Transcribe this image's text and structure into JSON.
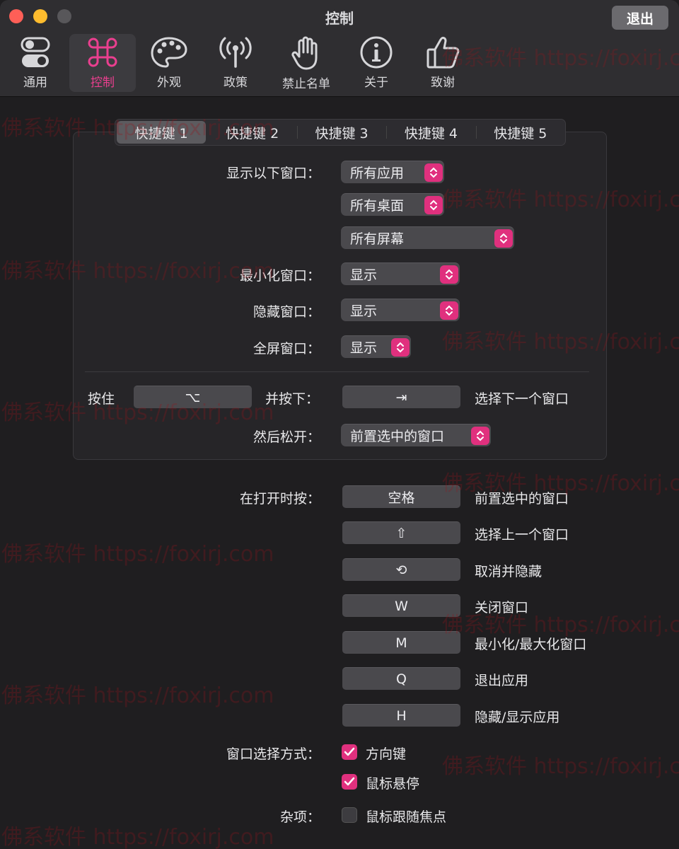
{
  "window": {
    "title": "控制",
    "quit_label": "退出"
  },
  "toolbar": [
    {
      "label": "通用",
      "icon": "toggle-icon"
    },
    {
      "label": "控制",
      "icon": "command-icon"
    },
    {
      "label": "外观",
      "icon": "palette-icon"
    },
    {
      "label": "政策",
      "icon": "antenna-icon"
    },
    {
      "label": "禁止名单",
      "icon": "hand-icon"
    },
    {
      "label": "关于",
      "icon": "info-icon"
    },
    {
      "label": "致谢",
      "icon": "thumbs-up-icon"
    }
  ],
  "shortcut_tabs": [
    "快捷键 1",
    "快捷键 2",
    "快捷键 3",
    "快捷键 4",
    "快捷键 5"
  ],
  "show_windows": {
    "label": "显示以下窗口：",
    "apps": "所有应用",
    "spaces": "所有桌面",
    "screens": "所有屏幕"
  },
  "minimized": {
    "label": "最小化窗口：",
    "value": "显示"
  },
  "hidden": {
    "label": "隐藏窗口：",
    "value": "显示"
  },
  "fullscreen": {
    "label": "全屏窗口：",
    "value": "显示"
  },
  "hotkey": {
    "hold_label": "按住",
    "hold_key": "⌥",
    "press_label": "并按下：",
    "press_key": "⇥",
    "press_action": "选择下一个窗口",
    "release_label": "然后松开：",
    "release_value": "前置选中的窗口"
  },
  "while_open": {
    "label": "在打开时按：",
    "rows": [
      {
        "key": "空格",
        "action": "前置选中的窗口"
      },
      {
        "key": "⇧",
        "action": "选择上一个窗口"
      },
      {
        "key": "⟲",
        "action": "取消并隐藏"
      },
      {
        "key": "W",
        "action": "关闭窗口"
      },
      {
        "key": "M",
        "action": "最小化/最大化窗口"
      },
      {
        "key": "Q",
        "action": "退出应用"
      },
      {
        "key": "H",
        "action": "隐藏/显示应用"
      }
    ]
  },
  "selection": {
    "label": "窗口选择方式：",
    "arrow_keys": "方向键",
    "mouse_hover": "鼠标悬停"
  },
  "misc": {
    "label": "杂项：",
    "focus_follows": "鼠标跟随焦点"
  },
  "watermark": "佛系软件 https://foxirj.com",
  "colors": {
    "accent": "#e0307e",
    "background": "#1f1e20",
    "toolbar": "#2f2e31"
  }
}
